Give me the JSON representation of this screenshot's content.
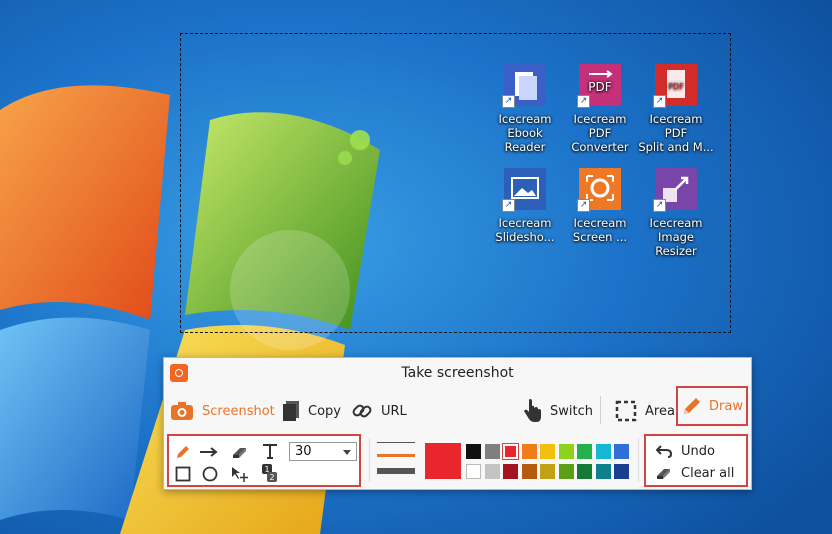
{
  "desktop": {
    "icons": [
      {
        "label_1": "Icecream",
        "label_2": "Ebook Reader",
        "icon": "ebook-reader-icon",
        "color": "#3a5fc8"
      },
      {
        "label_1": "Icecream PDF",
        "label_2": "Converter",
        "icon": "pdf-converter-icon",
        "color": "#c5307a"
      },
      {
        "label_1": "Icecream PDF",
        "label_2": "Split and M...",
        "icon": "pdf-split-merge-icon",
        "color": "#d42b2b"
      },
      {
        "label_1": "Icecream",
        "label_2": "Slidesho...",
        "icon": "slideshow-icon",
        "color": "#2b5fb8"
      },
      {
        "label_1": "Icecream",
        "label_2": "Screen ...",
        "icon": "screen-recorder-icon",
        "color": "#ef7826"
      },
      {
        "label_1": "Icecream",
        "label_2": "Image Resizer",
        "icon": "image-resizer-icon",
        "color": "#7a45a8"
      }
    ]
  },
  "toolbar": {
    "title": "Take screenshot",
    "screenshot_label": "Screenshot",
    "copy_label": "Copy",
    "url_label": "URL",
    "switch_label": "Switch",
    "area_label": "Area",
    "draw_label": "Draw",
    "size_value": "30",
    "undo_label": "Undo",
    "clear_label": "Clear all",
    "accent_color": "#e8742a",
    "selected_color": "#e8262b",
    "palette_row1": [
      "#111111",
      "#7f7f7f",
      "#e8262b",
      "#f07d1a",
      "#f2c10e",
      "#8ed21c",
      "#22b14c",
      "#16b7d6",
      "#2f6fd6"
    ],
    "palette_row2": [
      "#ffffff",
      "#c3c3c3",
      "#a3141f",
      "#b55a10",
      "#c3a015",
      "#5a9f14",
      "#157a35",
      "#0e7f8f",
      "#1b3f8f"
    ]
  }
}
